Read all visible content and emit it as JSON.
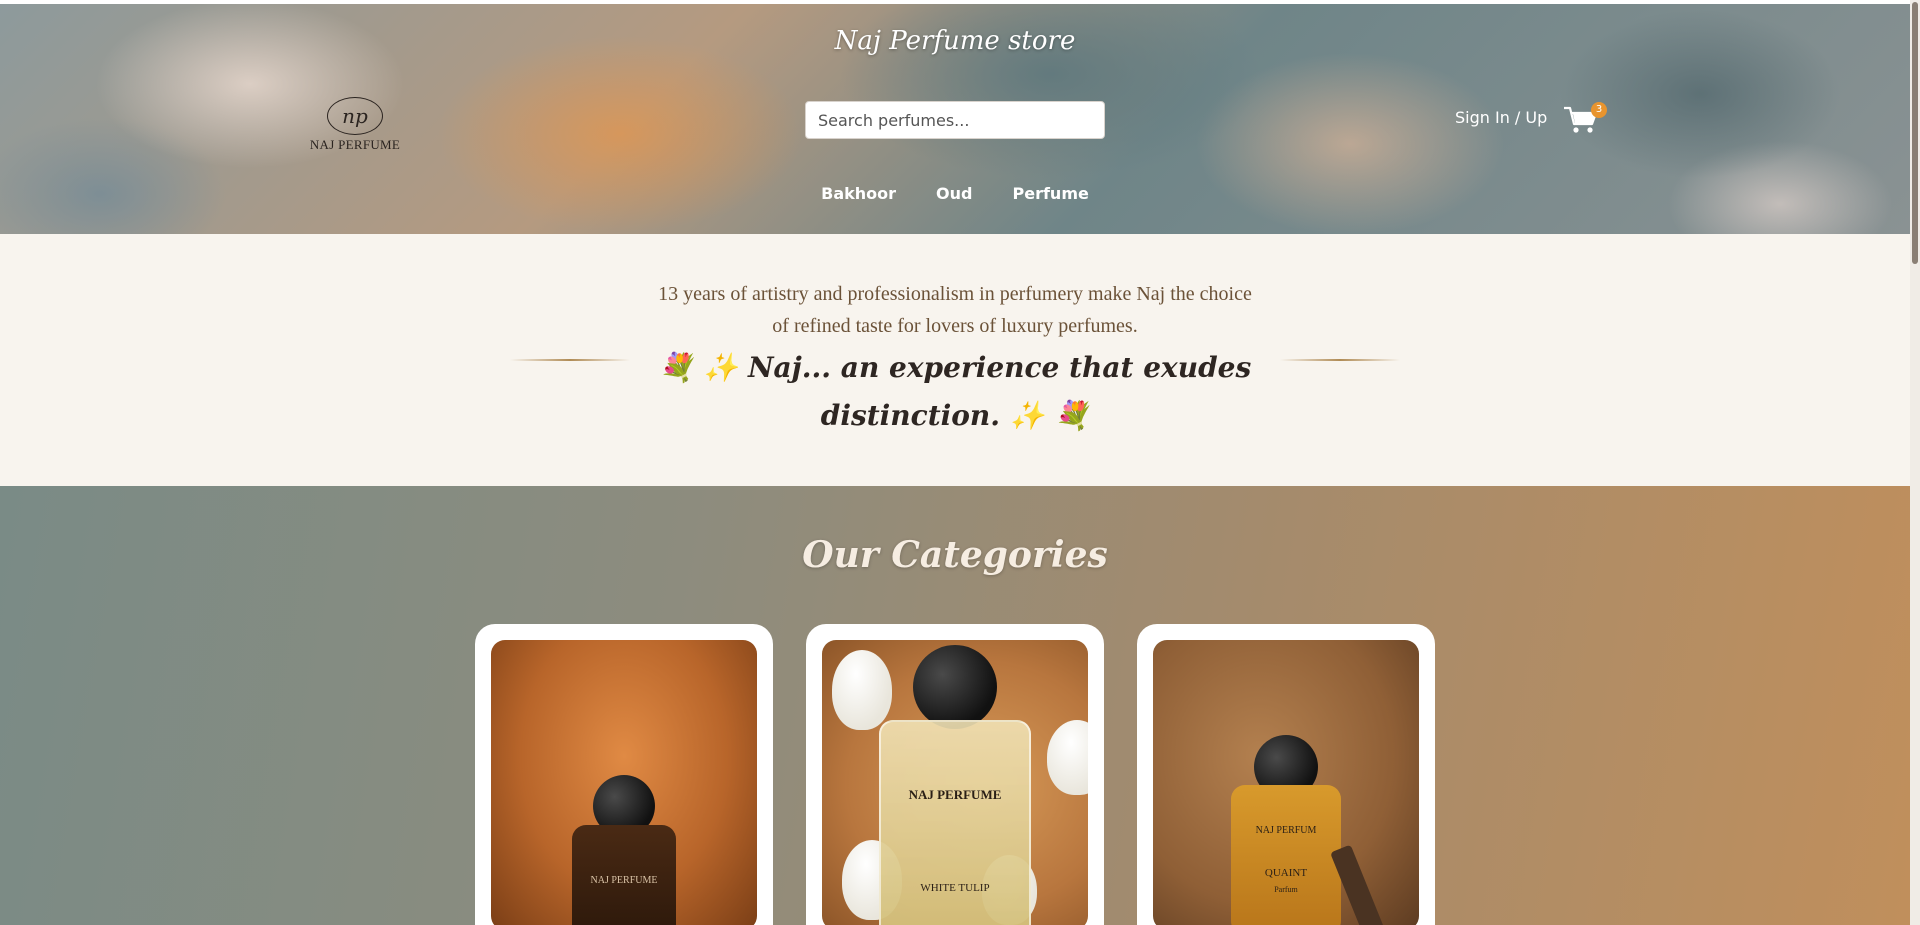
{
  "header": {
    "store_title": "Naj Perfume store",
    "logo_initials": "np",
    "logo_text": "NAJ PERFUME",
    "search_placeholder": "Search perfumes...",
    "signin_label": "Sign In / Up",
    "cart_count": "3",
    "cart_icon": "cart-icon",
    "nav": [
      {
        "label": "Bakhoor"
      },
      {
        "label": "Oud"
      },
      {
        "label": "Perfume"
      }
    ]
  },
  "intro": {
    "line1": "13 years of artistry and professionalism in perfumery make Naj the choice",
    "line2": "of refined taste for lovers of luxury perfumes.",
    "tagline1": "💐 ✨ Naj... an experience that exudes",
    "tagline2": "distinction. ✨ 💐"
  },
  "categories": {
    "title": "Our Categories",
    "cards": [
      {
        "image": "perfume-bottle-amber",
        "bottle_label": "NAJ PERFUME"
      },
      {
        "image": "perfume-bottle-white-tulips",
        "bottle_label": "NAJ PERFUME",
        "bottle_name": "WHITE TULIP"
      },
      {
        "image": "perfume-bottle-quaint",
        "bottle_label": "NAJ PERFUM",
        "bottle_name": "QUAINT",
        "bottle_sub": "Parfum"
      }
    ]
  },
  "colors": {
    "accent": "#e8942e",
    "intro_bg": "#f8f4ee",
    "intro_text": "#6b5238",
    "tagline": "#2e2622"
  }
}
